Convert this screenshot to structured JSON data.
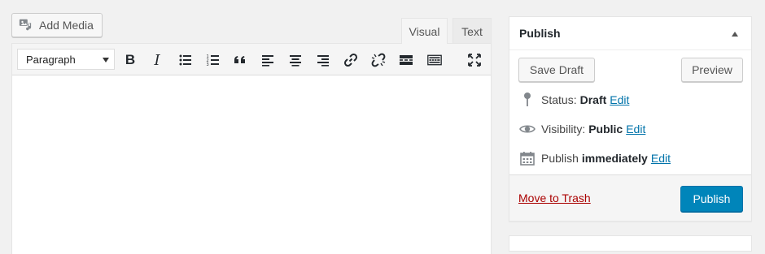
{
  "editor": {
    "add_media_label": "Add Media",
    "tabs": [
      {
        "label": "Visual"
      },
      {
        "label": "Text"
      }
    ],
    "format_select": "Paragraph",
    "toolbar_buttons": [
      {
        "icon": "bold-icon",
        "glyph": "B"
      },
      {
        "icon": "italic-icon",
        "glyph": "I"
      },
      {
        "icon": "bullet-list-icon"
      },
      {
        "icon": "numbered-list-icon"
      },
      {
        "icon": "blockquote-icon",
        "glyph": "“"
      },
      {
        "icon": "align-left-icon"
      },
      {
        "icon": "align-center-icon"
      },
      {
        "icon": "align-right-icon"
      },
      {
        "icon": "insert-link-icon"
      },
      {
        "icon": "remove-link-icon"
      },
      {
        "icon": "read-more-icon"
      },
      {
        "icon": "toolbar-toggle-icon"
      },
      {
        "icon": "fullscreen-icon"
      }
    ]
  },
  "publish": {
    "title": "Publish",
    "save_draft_label": "Save Draft",
    "preview_label": "Preview",
    "status": {
      "label": "Status:",
      "value": "Draft",
      "edit": "Edit"
    },
    "visibility": {
      "label": "Visibility:",
      "value": "Public",
      "edit": "Edit"
    },
    "schedule": {
      "label": "Publish",
      "value": "immediately",
      "edit": "Edit"
    },
    "trash_label": "Move to Trash",
    "publish_label": "Publish",
    "colors": {
      "primary": "#0085ba",
      "link": "#0073aa",
      "trash": "#aa0000"
    }
  }
}
